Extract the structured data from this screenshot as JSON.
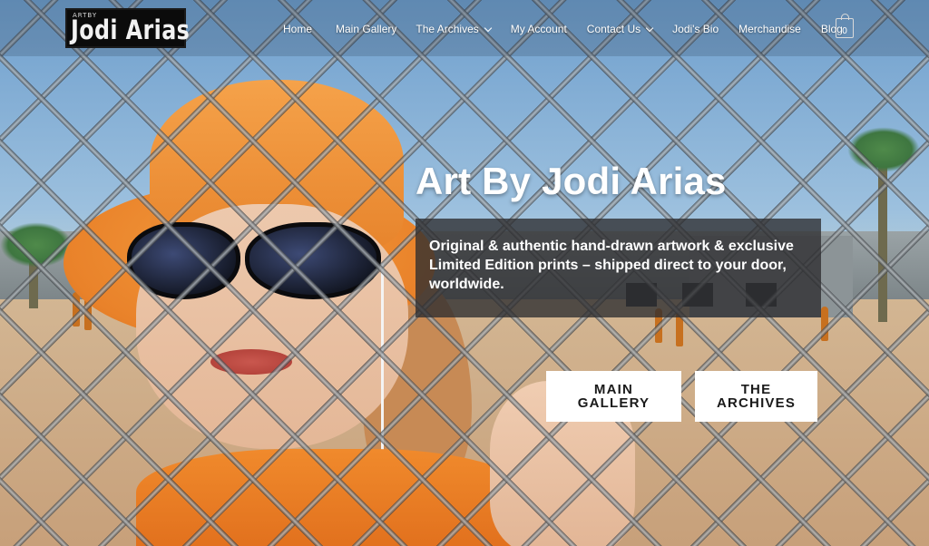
{
  "logo": {
    "small_text": "ARTBY",
    "name": "Jodi Arias"
  },
  "nav": {
    "items": [
      {
        "label": "Home",
        "has_dropdown": false
      },
      {
        "label": "Main Gallery",
        "has_dropdown": false
      },
      {
        "label": "The Archives",
        "has_dropdown": true
      },
      {
        "label": "My Account",
        "has_dropdown": false
      },
      {
        "label": "Contact Us",
        "has_dropdown": true
      },
      {
        "label": "Jodi's Bio",
        "has_dropdown": false
      },
      {
        "label": "Merchandise",
        "has_dropdown": false
      },
      {
        "label": "Blog",
        "has_dropdown": false
      }
    ],
    "cart": {
      "icon": "shopping-bag-icon",
      "count": "0"
    }
  },
  "hero": {
    "title": "Art By Jodi Arias",
    "description": "Original & authentic hand-drawn artwork & exclusive Limited Edition prints – shipped direct to your door, worldwide.",
    "buttons": {
      "main_gallery": "MAIN\nGALLERY",
      "archives": "THE\nARCHIVES"
    }
  },
  "colors": {
    "button_bg": "#ffffff",
    "text_box_bg": "#2d2d30",
    "accent_orange": "#e9822a"
  }
}
